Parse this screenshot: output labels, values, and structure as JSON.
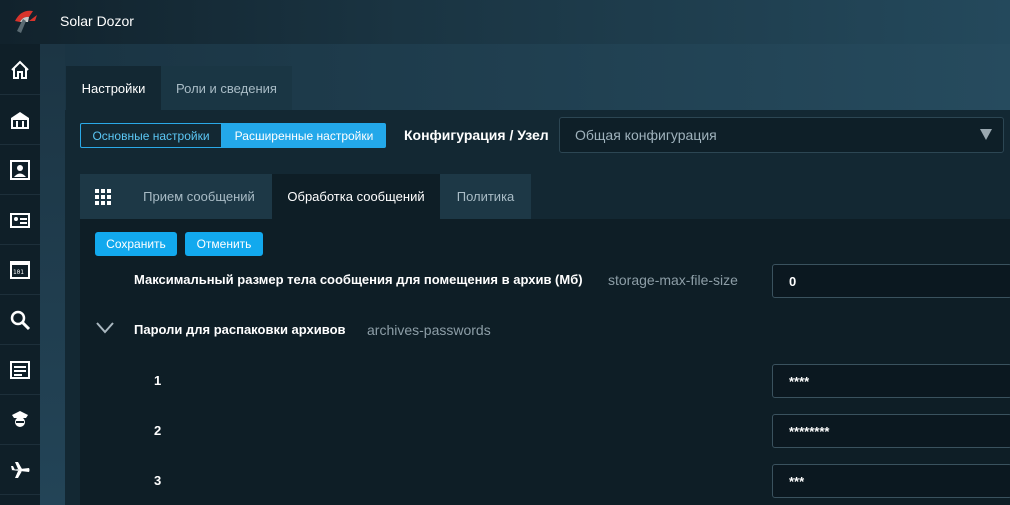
{
  "app": {
    "title": "Solar Dozor"
  },
  "sidebar": {
    "items": [
      {
        "icon": "home-icon"
      },
      {
        "icon": "building-icon"
      },
      {
        "icon": "person-card-icon"
      },
      {
        "icon": "id-card-icon"
      },
      {
        "icon": "binary-calendar-icon"
      },
      {
        "icon": "search-icon"
      },
      {
        "icon": "list-icon"
      },
      {
        "icon": "police-officer-icon"
      },
      {
        "icon": "airplane-icon"
      }
    ]
  },
  "top_tabs": [
    {
      "label": "Настройки",
      "active": true
    },
    {
      "label": "Роли и сведения",
      "active": false
    }
  ],
  "mode_toggle": {
    "basic": "Основные настройки",
    "advanced": "Расширенные настройки",
    "selected": "advanced"
  },
  "config": {
    "label": "Конфигурация / Узел",
    "select_value": "Общая конфигурация"
  },
  "inner_tabs": [
    {
      "label": "Прием сообщений",
      "active": false
    },
    {
      "label": "Обработка сообщений",
      "active": true
    },
    {
      "label": "Политика",
      "active": false
    }
  ],
  "actions": {
    "save": "Сохранить",
    "cancel": "Отменить"
  },
  "settings": {
    "max_size": {
      "label": "Максимальный размер тела сообщения для помещения в архив (Мб)",
      "key": "storage-max-file-size",
      "value": "0"
    },
    "passwords": {
      "label": "Пароли для распаковки архивов",
      "key": "archives-passwords",
      "expanded": true,
      "items": [
        {
          "index": "1",
          "value": "****"
        },
        {
          "index": "2",
          "value": "********"
        },
        {
          "index": "3",
          "value": "***"
        }
      ]
    }
  },
  "colors": {
    "accent": "#12a9ee",
    "sidebar": "#0f1f28",
    "panel": "#0e1e26"
  }
}
